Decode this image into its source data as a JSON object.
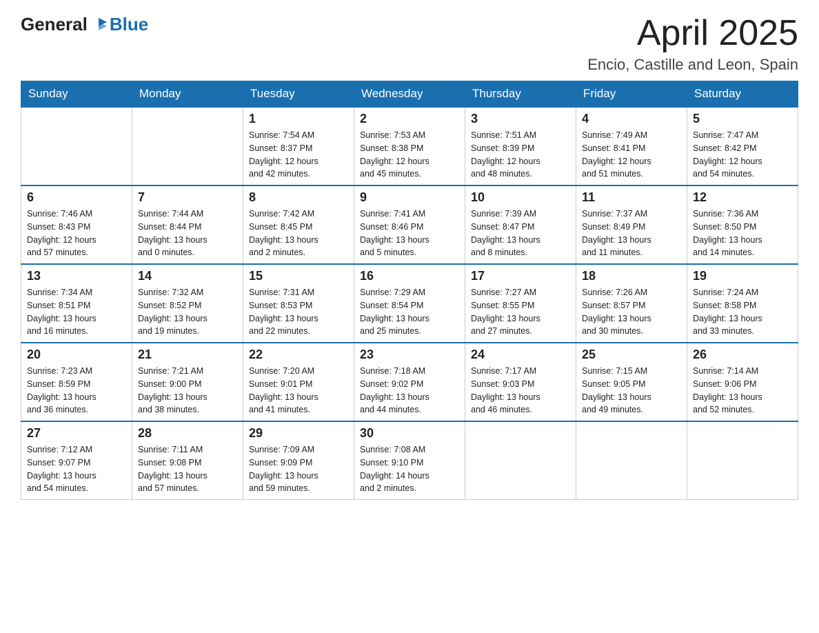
{
  "header": {
    "logo_general": "General",
    "logo_blue": "Blue",
    "month_year": "April 2025",
    "location": "Encio, Castille and Leon, Spain"
  },
  "weekdays": [
    "Sunday",
    "Monday",
    "Tuesday",
    "Wednesday",
    "Thursday",
    "Friday",
    "Saturday"
  ],
  "weeks": [
    [
      {
        "day": "",
        "info": ""
      },
      {
        "day": "",
        "info": ""
      },
      {
        "day": "1",
        "info": "Sunrise: 7:54 AM\nSunset: 8:37 PM\nDaylight: 12 hours\nand 42 minutes."
      },
      {
        "day": "2",
        "info": "Sunrise: 7:53 AM\nSunset: 8:38 PM\nDaylight: 12 hours\nand 45 minutes."
      },
      {
        "day": "3",
        "info": "Sunrise: 7:51 AM\nSunset: 8:39 PM\nDaylight: 12 hours\nand 48 minutes."
      },
      {
        "day": "4",
        "info": "Sunrise: 7:49 AM\nSunset: 8:41 PM\nDaylight: 12 hours\nand 51 minutes."
      },
      {
        "day": "5",
        "info": "Sunrise: 7:47 AM\nSunset: 8:42 PM\nDaylight: 12 hours\nand 54 minutes."
      }
    ],
    [
      {
        "day": "6",
        "info": "Sunrise: 7:46 AM\nSunset: 8:43 PM\nDaylight: 12 hours\nand 57 minutes."
      },
      {
        "day": "7",
        "info": "Sunrise: 7:44 AM\nSunset: 8:44 PM\nDaylight: 13 hours\nand 0 minutes."
      },
      {
        "day": "8",
        "info": "Sunrise: 7:42 AM\nSunset: 8:45 PM\nDaylight: 13 hours\nand 2 minutes."
      },
      {
        "day": "9",
        "info": "Sunrise: 7:41 AM\nSunset: 8:46 PM\nDaylight: 13 hours\nand 5 minutes."
      },
      {
        "day": "10",
        "info": "Sunrise: 7:39 AM\nSunset: 8:47 PM\nDaylight: 13 hours\nand 8 minutes."
      },
      {
        "day": "11",
        "info": "Sunrise: 7:37 AM\nSunset: 8:49 PM\nDaylight: 13 hours\nand 11 minutes."
      },
      {
        "day": "12",
        "info": "Sunrise: 7:36 AM\nSunset: 8:50 PM\nDaylight: 13 hours\nand 14 minutes."
      }
    ],
    [
      {
        "day": "13",
        "info": "Sunrise: 7:34 AM\nSunset: 8:51 PM\nDaylight: 13 hours\nand 16 minutes."
      },
      {
        "day": "14",
        "info": "Sunrise: 7:32 AM\nSunset: 8:52 PM\nDaylight: 13 hours\nand 19 minutes."
      },
      {
        "day": "15",
        "info": "Sunrise: 7:31 AM\nSunset: 8:53 PM\nDaylight: 13 hours\nand 22 minutes."
      },
      {
        "day": "16",
        "info": "Sunrise: 7:29 AM\nSunset: 8:54 PM\nDaylight: 13 hours\nand 25 minutes."
      },
      {
        "day": "17",
        "info": "Sunrise: 7:27 AM\nSunset: 8:55 PM\nDaylight: 13 hours\nand 27 minutes."
      },
      {
        "day": "18",
        "info": "Sunrise: 7:26 AM\nSunset: 8:57 PM\nDaylight: 13 hours\nand 30 minutes."
      },
      {
        "day": "19",
        "info": "Sunrise: 7:24 AM\nSunset: 8:58 PM\nDaylight: 13 hours\nand 33 minutes."
      }
    ],
    [
      {
        "day": "20",
        "info": "Sunrise: 7:23 AM\nSunset: 8:59 PM\nDaylight: 13 hours\nand 36 minutes."
      },
      {
        "day": "21",
        "info": "Sunrise: 7:21 AM\nSunset: 9:00 PM\nDaylight: 13 hours\nand 38 minutes."
      },
      {
        "day": "22",
        "info": "Sunrise: 7:20 AM\nSunset: 9:01 PM\nDaylight: 13 hours\nand 41 minutes."
      },
      {
        "day": "23",
        "info": "Sunrise: 7:18 AM\nSunset: 9:02 PM\nDaylight: 13 hours\nand 44 minutes."
      },
      {
        "day": "24",
        "info": "Sunrise: 7:17 AM\nSunset: 9:03 PM\nDaylight: 13 hours\nand 46 minutes."
      },
      {
        "day": "25",
        "info": "Sunrise: 7:15 AM\nSunset: 9:05 PM\nDaylight: 13 hours\nand 49 minutes."
      },
      {
        "day": "26",
        "info": "Sunrise: 7:14 AM\nSunset: 9:06 PM\nDaylight: 13 hours\nand 52 minutes."
      }
    ],
    [
      {
        "day": "27",
        "info": "Sunrise: 7:12 AM\nSunset: 9:07 PM\nDaylight: 13 hours\nand 54 minutes."
      },
      {
        "day": "28",
        "info": "Sunrise: 7:11 AM\nSunset: 9:08 PM\nDaylight: 13 hours\nand 57 minutes."
      },
      {
        "day": "29",
        "info": "Sunrise: 7:09 AM\nSunset: 9:09 PM\nDaylight: 13 hours\nand 59 minutes."
      },
      {
        "day": "30",
        "info": "Sunrise: 7:08 AM\nSunset: 9:10 PM\nDaylight: 14 hours\nand 2 minutes."
      },
      {
        "day": "",
        "info": ""
      },
      {
        "day": "",
        "info": ""
      },
      {
        "day": "",
        "info": ""
      }
    ]
  ]
}
